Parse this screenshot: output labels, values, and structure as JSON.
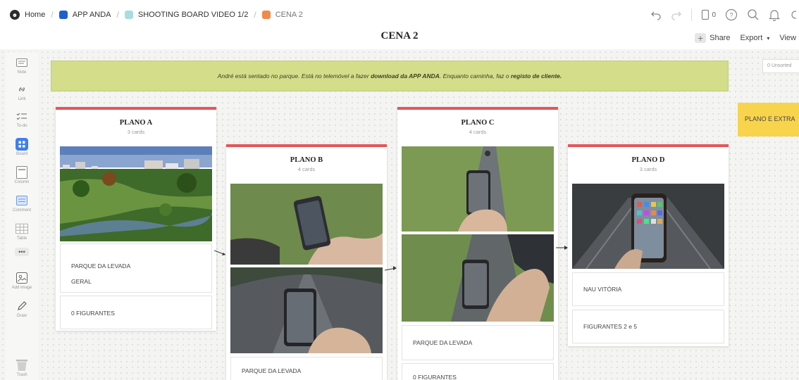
{
  "breadcrumbs": [
    {
      "label": "Home",
      "color": "#2b2b2b"
    },
    {
      "label": "APP ANDA",
      "color": "#1c5fd1"
    },
    {
      "label": "SHOOTING BOARD VIDEO 1/2",
      "color": "#a8dde0"
    },
    {
      "label": "CENA 2",
      "color": "#ef8a4a"
    }
  ],
  "page_title": "CENA 2",
  "header": {
    "notification_count": "0",
    "share_label": "Share",
    "export_label": "Export",
    "view_label": "View"
  },
  "toolbar": [
    {
      "label": "Note",
      "icon": "note-icon"
    },
    {
      "label": "Link",
      "icon": "link-icon"
    },
    {
      "label": "To-do",
      "icon": "todo-icon"
    },
    {
      "label": "Board",
      "icon": "board-icon"
    },
    {
      "label": "Column",
      "icon": "column-icon"
    },
    {
      "label": "Comment",
      "icon": "comment-icon"
    },
    {
      "label": "Table",
      "icon": "table-icon"
    },
    {
      "label": "•••",
      "icon": "more-icon"
    },
    {
      "label": "Add image",
      "icon": "add-image-icon"
    },
    {
      "label": "Draw",
      "icon": "draw-icon"
    },
    {
      "label": "Trash",
      "icon": "trash-icon"
    }
  ],
  "banner": {
    "part1": "André está sentado no parque. Está no telemóvel a fazer ",
    "bold1": "download da APP ANDA",
    "part2": ". Enquanto caminha, faz o ",
    "bold2": "registo de  cliente."
  },
  "unsorted_label": "0 Unsorted",
  "extra_label": "PLANO E EXTRA",
  "columns": [
    {
      "title": "PLANO A",
      "count": "3 cards",
      "cards": [
        "PARQUE DA LEVADA",
        "GERAL",
        "0 FIGURANTES"
      ]
    },
    {
      "title": "PLANO B",
      "count": "4 cards",
      "cards": [
        "PARQUE DA LEVADA"
      ]
    },
    {
      "title": "PLANO C",
      "count": "4 cards",
      "cards": [
        "PARQUE DA LEVADA",
        "0 FIGURANTES"
      ]
    },
    {
      "title": "PLANO D",
      "count": "3 cards",
      "cards": [
        "NAU VITÓRIA",
        "FIGURANTES 2 e 5"
      ]
    }
  ],
  "colors": {
    "accent": "#e4555a",
    "banner": "#d3dd8a",
    "sticky": "#f8d44c"
  }
}
